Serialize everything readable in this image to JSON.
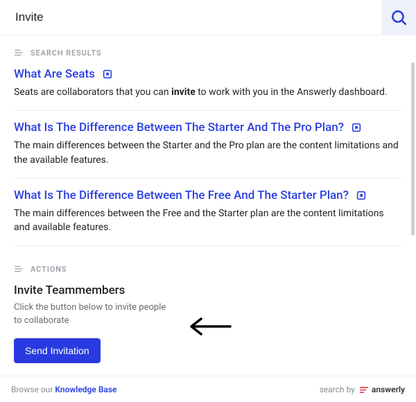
{
  "search": {
    "value": "Invite"
  },
  "sections": {
    "results_label": "SEARCH RESULTS",
    "actions_label": "ACTIONS"
  },
  "results": [
    {
      "title": "What Are Seats",
      "snippet_pre": "Seats are collaborators that you can ",
      "snippet_em": "invite",
      "snippet_post": " to work with you in the Answerly dashboard."
    },
    {
      "title": "What Is The Difference Between The Starter And The Pro Plan?",
      "snippet_pre": "The main differences between the Starter and the Pro plan are the content limitations and the available features.",
      "snippet_em": "",
      "snippet_post": ""
    },
    {
      "title": "What Is The Difference Between The Free And The Starter Plan?",
      "snippet_pre": "The main differences between the Free and the Starter plan are the content limitations and available features.",
      "snippet_em": "",
      "snippet_post": ""
    }
  ],
  "action": {
    "title": "Invite Teammembers",
    "description": "Click the button below to invite people to collaborate",
    "button_label": "Send Invitation"
  },
  "footer": {
    "browse_prefix": "Browse our ",
    "browse_link": "Knowledge Base",
    "search_by": "search by",
    "brand": "answerly"
  }
}
